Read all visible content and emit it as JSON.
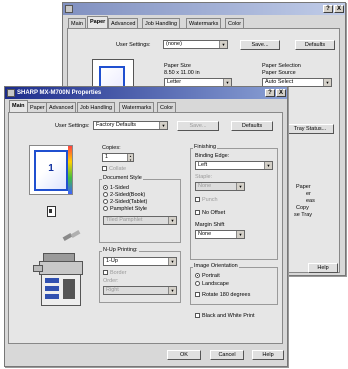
{
  "back": {
    "help_btn": "?",
    "close_btn": "X",
    "tabs": [
      "Main",
      "Paper",
      "Advanced",
      "Job Handling",
      "Watermarks",
      "Color"
    ],
    "user_settings_label": "User Settings:",
    "user_settings_value": "(none)",
    "save_label": "Save...",
    "defaults_label": "Defaults",
    "paper_size_label": "Paper Size",
    "paper_size_dims": "8.50 x 11.00 in",
    "paper_size_value": "Letter",
    "paper_selection_label": "Paper Selection",
    "paper_source_label": "Paper Source",
    "paper_source_value": "Auto Select",
    "tray_status_label": "Tray Status...",
    "bits": [
      "Paper",
      "er",
      "eas",
      "Copy",
      "se Tray"
    ],
    "help_label": "Help"
  },
  "front": {
    "title": "SHARP MX-M700N Properties",
    "help_btn": "?",
    "close_btn": "X",
    "tabs": [
      "Main",
      "Paper",
      "Advanced",
      "Job Handling",
      "Watermarks",
      "Color"
    ],
    "user_settings_label": "User Settings:",
    "user_settings_value": "Factory Defaults",
    "save_label": "Save...",
    "defaults_label": "Defaults",
    "preview_number": "1",
    "copies_label": "Copies:",
    "copies_value": "1",
    "collate_label": "Collate",
    "document_style_label": "Document Style",
    "doc_styles": [
      "1-Sided",
      "2-Sided(Book)",
      "2-Sided(Tablet)",
      "Pamphlet Style"
    ],
    "tiled_value": "Tiled Pamphlet",
    "nup_label": "N-Up Printing:",
    "nup_value": "1-Up",
    "border_label": "Border",
    "order_label": "Order:",
    "order_value": "Right",
    "finishing_label": "Finishing",
    "binding_edge_label": "Binding Edge:",
    "binding_edge_value": "Left",
    "staple_label": "Staple:",
    "staple_value": "None",
    "punch_label": "Punch",
    "no_offset_label": "No Offset",
    "margin_shift_label": "Margin Shift",
    "margin_shift_value": "None",
    "image_orientation_label": "Image Orientation",
    "portrait_label": "Portrait",
    "landscape_label": "Landscape",
    "rotate_label": "Rotate 180 degrees",
    "bw_print_label": "Black and White Print",
    "ok_label": "OK",
    "cancel_label": "Cancel",
    "help_label": "Help"
  }
}
